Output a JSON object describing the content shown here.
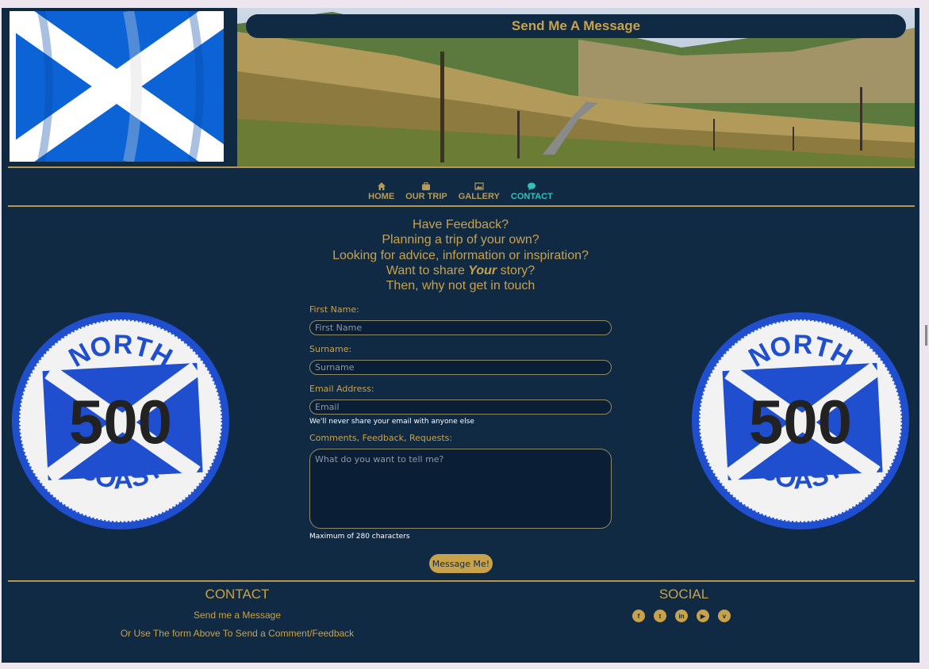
{
  "header": {
    "title": "Send Me A Message"
  },
  "nav": {
    "items": [
      {
        "label": "HOME",
        "icon": "home-icon"
      },
      {
        "label": "OUR TRIP",
        "icon": "briefcase-icon"
      },
      {
        "label": "GALLERY",
        "icon": "image-icon"
      },
      {
        "label": "CONTACT",
        "icon": "chat-icon",
        "active": true
      }
    ]
  },
  "intro": {
    "line1": "Have Feedback?",
    "line2": "Planning a trip of your own?",
    "line3": "Looking for advice, information or inspiration?",
    "line4_pre": "Want to share ",
    "line4_em": "Your",
    "line4_post": " story?",
    "line5": "Then, why not get in touch"
  },
  "badge": {
    "top": "NORTH",
    "number": "500",
    "bottom": "COAST"
  },
  "form": {
    "first_name_label": "First Name:",
    "first_name_placeholder": "First Name",
    "surname_label": "Surname:",
    "surname_placeholder": "Surname",
    "email_label": "Email Address:",
    "email_placeholder": "Email",
    "email_note": "We'll never share your email with anyone else",
    "comments_label": "Comments, Feedback, Requests:",
    "comments_placeholder": "What do you want to tell me?",
    "comments_note": "Maximum of 280 characters",
    "submit_label": "Message Me!"
  },
  "footer": {
    "contact_heading": "CONTACT",
    "contact_link": "Send me a Message",
    "contact_text": "Or Use The form Above To Send a Comment/Feedback",
    "social_heading": "SOCIAL",
    "social": [
      {
        "name": "facebook-icon",
        "glyph": "f"
      },
      {
        "name": "twitter-icon",
        "glyph": "t"
      },
      {
        "name": "linkedin-icon",
        "glyph": "in"
      },
      {
        "name": "youtube-icon",
        "glyph": "▶"
      },
      {
        "name": "vimeo-icon",
        "glyph": "v"
      }
    ]
  },
  "colors": {
    "background": "#112a44",
    "accent": "#c8a24a",
    "active": "#2fc2bb"
  }
}
